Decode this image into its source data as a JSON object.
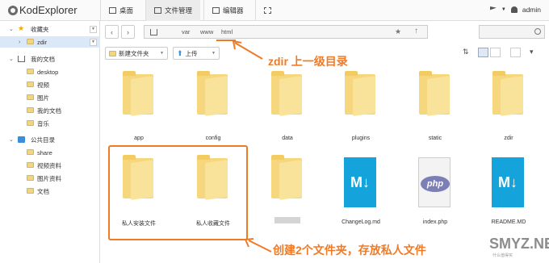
{
  "app": {
    "name": "KodExplorer"
  },
  "topnav": {
    "tabs": [
      {
        "label": "桌面"
      },
      {
        "label": "文件管理"
      },
      {
        "label": "编辑器"
      },
      {
        "label": ""
      }
    ],
    "user": "admin"
  },
  "sidebar": {
    "favorites": {
      "label": "收藏夹",
      "items": [
        {
          "label": "zdir"
        }
      ]
    },
    "mydocs": {
      "label": "我的文档",
      "items": [
        {
          "label": "desktop"
        },
        {
          "label": "视频"
        },
        {
          "label": "图片"
        },
        {
          "label": "我的文档"
        },
        {
          "label": "音乐"
        }
      ]
    },
    "public": {
      "label": "公共目录",
      "items": [
        {
          "label": "share"
        },
        {
          "label": "视频资料"
        },
        {
          "label": "图片资料"
        },
        {
          "label": "文档"
        }
      ]
    }
  },
  "breadcrumb": [
    "var",
    "www",
    "html"
  ],
  "toolbar": {
    "new_folder": "新建文件夹",
    "upload": "上传"
  },
  "files": [
    {
      "name": "app",
      "type": "folder"
    },
    {
      "name": "config",
      "type": "folder"
    },
    {
      "name": "data",
      "type": "folder"
    },
    {
      "name": "plugins",
      "type": "folder"
    },
    {
      "name": "static",
      "type": "folder"
    },
    {
      "name": "zdir",
      "type": "folder"
    },
    {
      "name": "私人安装文件",
      "type": "folder"
    },
    {
      "name": "私人收藏文件",
      "type": "folder"
    },
    {
      "name": "",
      "type": "folder"
    },
    {
      "name": "ChangeLog.md",
      "type": "markdown"
    },
    {
      "name": "index.php",
      "type": "php"
    },
    {
      "name": "README.MD",
      "type": "markdown"
    }
  ],
  "annotations": {
    "top": "zdir 上一级目录",
    "bottom": "创建2个文件夹，存放私人文件"
  },
  "watermark": {
    "text": "SMYZ.NET",
    "sub": "什么值得买"
  },
  "colors": {
    "accent": "#f07a26",
    "selection": "#dbe8f7",
    "folder": "#f7d77e",
    "markdown": "#15a3dc"
  }
}
